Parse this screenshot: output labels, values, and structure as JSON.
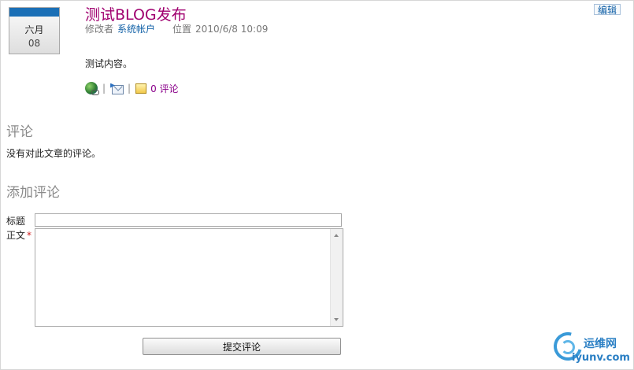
{
  "post": {
    "date_month": "六月",
    "date_day": "08",
    "title": "测试BLOG发布",
    "meta": {
      "modifier_label": "修改者",
      "modifier_value": "系统帐户",
      "location_label": "位置",
      "location_value": "2010/6/8 10:09"
    },
    "edit_label": "编辑",
    "body": "测试内容。",
    "toolbar": {
      "icons": [
        "globe-link-icon",
        "email-link-icon",
        "comment-icon"
      ],
      "separator": "|",
      "comment_count": "0 评论"
    }
  },
  "comments": {
    "heading": "评论",
    "empty_text": "没有对此文章的评论。"
  },
  "add_comment": {
    "heading": "添加评论",
    "title_label": "标题",
    "title_value": "",
    "body_label": "正文",
    "required_marker": "*",
    "body_value": "",
    "submit_label": "提交评论"
  },
  "watermark": {
    "top": "运维网",
    "bottom": "iyunv.com"
  },
  "colors": {
    "title": "#a0006f",
    "link": "#0f5fa6",
    "comment_count": "#8a008a",
    "heading": "#8a8a8a",
    "badge_bar": "#1a6fb6",
    "required": "#d01f1f",
    "watermark": "#2a7fc4"
  }
}
